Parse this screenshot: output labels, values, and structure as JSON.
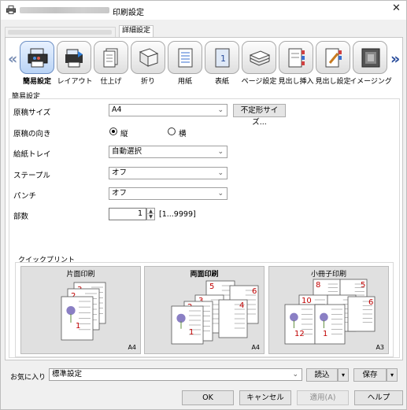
{
  "window": {
    "title": "印刷設定",
    "close_glyph": "✕"
  },
  "tabs": [
    {
      "label": ""
    },
    {
      "label": "詳細設定"
    }
  ],
  "toolbar": {
    "prev_arrow": "«",
    "next_arrow": "»",
    "items": [
      {
        "label": "簡易設定",
        "icon": "quick-setting-icon",
        "selected": true
      },
      {
        "label": "レイアウト",
        "icon": "layout-icon"
      },
      {
        "label": "仕上げ",
        "icon": "finishing-icon"
      },
      {
        "label": "折り",
        "icon": "fold-icon"
      },
      {
        "label": "用紙",
        "icon": "paper-icon"
      },
      {
        "label": "表紙",
        "icon": "cover-icon"
      },
      {
        "label": "ページ設定",
        "icon": "page-setup-icon"
      },
      {
        "label": "見出し挿入",
        "icon": "tab-insert-icon"
      },
      {
        "label": "見出し設定",
        "icon": "tab-settings-icon"
      },
      {
        "label": "イメージング",
        "icon": "imaging-icon"
      }
    ]
  },
  "quick": {
    "section_title": "簡易設定",
    "original_size": {
      "label": "原稿サイズ",
      "value": "A4",
      "custom_button": "不定形サイズ..."
    },
    "orientation": {
      "label": "原稿の向き",
      "options": [
        "縦",
        "横"
      ],
      "selected": "縦"
    },
    "paper_tray": {
      "label": "給紙トレイ",
      "value": "自動選択"
    },
    "staple": {
      "label": "ステープル",
      "value": "オフ"
    },
    "punch": {
      "label": "パンチ",
      "value": "オフ"
    },
    "copies": {
      "label": "部数",
      "value": "1",
      "range": "[1...9999]"
    }
  },
  "quick_print": {
    "section_title": "クイックプリント",
    "cards": [
      {
        "title": "片面印刷",
        "size": "A4",
        "pages": [
          "3",
          "2",
          "1"
        ]
      },
      {
        "title": "両面印刷",
        "size": "A4",
        "pages": [
          "5",
          "6",
          "3",
          "4",
          "2",
          "1"
        ]
      },
      {
        "title": "小冊子印刷",
        "size": "A3",
        "pages": [
          "8",
          "5",
          "10",
          "3",
          "6",
          "12",
          "1"
        ]
      }
    ]
  },
  "favorites": {
    "label": "お気に入り",
    "value": "標準設定",
    "load_button": "読込",
    "save_button": "保存"
  },
  "footer": {
    "ok": "OK",
    "cancel": "キャンセル",
    "apply": "適用(A)",
    "help": "ヘルプ"
  },
  "colors": {
    "accent": "#2b4e9c",
    "page_number": "#c00000"
  }
}
